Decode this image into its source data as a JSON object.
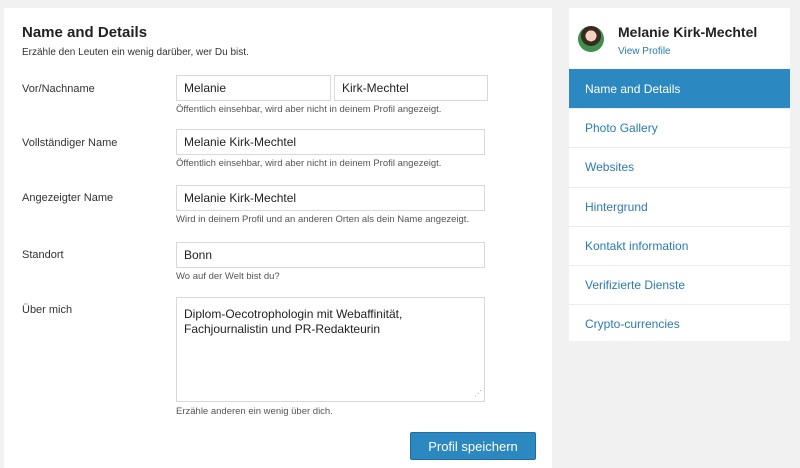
{
  "main": {
    "title": "Name and Details",
    "subtitle": "Erzähle den Leuten ein wenig darüber, wer Du bist.",
    "fields": {
      "first_last": {
        "label": "Vor/Nachname",
        "first_value": "Melanie",
        "last_value": "Kirk-Mechtel",
        "hint": "Öffentlich einsehbar, wird aber nicht in deinem Profil angezeigt."
      },
      "full_name": {
        "label": "Vollständiger Name",
        "value": "Melanie Kirk-Mechtel",
        "hint": "Öffentlich einsehbar, wird aber nicht in deinem Profil angezeigt."
      },
      "display_name": {
        "label": "Angezeigter Name",
        "value": "Melanie Kirk-Mechtel",
        "hint": "Wird in deinem Profil und an anderen Orten als dein Name angezeigt."
      },
      "location": {
        "label": "Standort",
        "value": "Bonn",
        "hint": "Wo auf der Welt bist du?"
      },
      "about": {
        "label": "Über mich",
        "value": "Diplom-Oecotrophologin mit Webaffinität,\nFachjournalistin und PR-Redakteurin",
        "hint": "Erzähle anderen ein wenig über dich."
      }
    },
    "save_label": "Profil speichern"
  },
  "sidebar": {
    "profile_name": "Melanie Kirk-Mechtel",
    "view_profile": "View Profile",
    "menu": [
      {
        "label": "Name and Details",
        "active": true
      },
      {
        "label": "Photo Gallery"
      },
      {
        "label": "Websites"
      },
      {
        "label": "Hintergrund"
      },
      {
        "label": "Kontakt information"
      },
      {
        "label": "Verifizierte Dienste"
      },
      {
        "label": "Crypto-currencies"
      }
    ]
  },
  "colors": {
    "accent": "#2b88c0",
    "link": "#2b7bb9",
    "background": "#f1f1f1"
  }
}
